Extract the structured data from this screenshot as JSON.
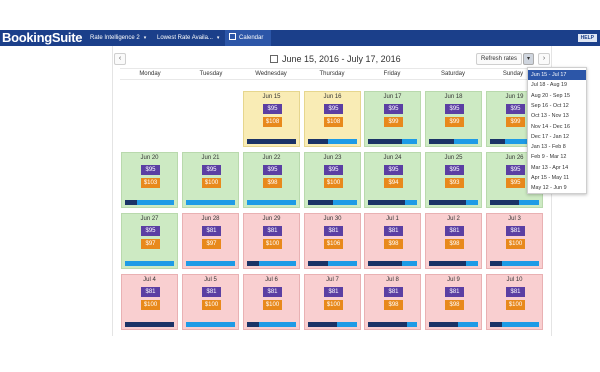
{
  "header": {
    "logo": "BookingSuite",
    "nav": [
      {
        "label": "Rate Intelligence 2",
        "caret": "▾"
      },
      {
        "label": "Lowest Rate Availa...",
        "caret": "▾"
      },
      {
        "label": "Calendar",
        "caret": ""
      }
    ],
    "help": "HELP"
  },
  "toolbar": {
    "prev": "‹",
    "next": "›",
    "date_range": "June 15, 2016 - July 17, 2016",
    "refresh": "Refresh rates",
    "dropdown_toggle": "▾"
  },
  "weekdays": [
    "Monday",
    "Tuesday",
    "Wednesday",
    "Thursday",
    "Friday",
    "Saturday",
    "Sunday"
  ],
  "calendar": [
    {
      "date": "Jun 15",
      "rate": "$95",
      "compare": "$108",
      "status": "yellow",
      "bar_fill": 1.0
    },
    {
      "date": "Jun 16",
      "rate": "$95",
      "compare": "$108",
      "status": "yellow",
      "bar_fill": 0.4
    },
    {
      "date": "Jun 17",
      "rate": "$95",
      "compare": "$99",
      "status": "green",
      "bar_fill": 0.7
    },
    {
      "date": "Jun 18",
      "rate": "$95",
      "compare": "$99",
      "status": "green",
      "bar_fill": 0.5
    },
    {
      "date": "Jun 19",
      "rate": "$95",
      "compare": "$99",
      "status": "green",
      "bar_fill": 0.3
    },
    {
      "date": "Jun 20",
      "rate": "$95",
      "compare": "$103",
      "status": "green",
      "bar_fill": 0.25
    },
    {
      "date": "Jun 21",
      "rate": "$95",
      "compare": "$100",
      "status": "green",
      "bar_fill": 0.0
    },
    {
      "date": "Jun 22",
      "rate": "$95",
      "compare": "$98",
      "status": "green",
      "bar_fill": 0.0
    },
    {
      "date": "Jun 23",
      "rate": "$95",
      "compare": "$100",
      "status": "green",
      "bar_fill": 0.5
    },
    {
      "date": "Jun 24",
      "rate": "$95",
      "compare": "$94",
      "status": "green",
      "bar_fill": 0.75
    },
    {
      "date": "Jun 25",
      "rate": "$95",
      "compare": "$93",
      "status": "green",
      "bar_fill": 0.75
    },
    {
      "date": "Jun 26",
      "rate": "$95",
      "compare": "$95",
      "status": "green",
      "bar_fill": 0.6
    },
    {
      "date": "Jun 27",
      "rate": "$95",
      "compare": "$97",
      "status": "green",
      "bar_fill": 0.0
    },
    {
      "date": "Jun 28",
      "rate": "$81",
      "compare": "$97",
      "status": "red",
      "bar_fill": 0.0
    },
    {
      "date": "Jun 29",
      "rate": "$81",
      "compare": "$100",
      "status": "red",
      "bar_fill": 0.25
    },
    {
      "date": "Jun 30",
      "rate": "$81",
      "compare": "$106",
      "status": "red",
      "bar_fill": 0.4
    },
    {
      "date": "Jul 1",
      "rate": "$81",
      "compare": "$98",
      "status": "red",
      "bar_fill": 0.7
    },
    {
      "date": "Jul 2",
      "rate": "$81",
      "compare": "$98",
      "status": "red",
      "bar_fill": 0.75
    },
    {
      "date": "Jul 3",
      "rate": "$81",
      "compare": "$100",
      "status": "red",
      "bar_fill": 0.25
    },
    {
      "date": "Jul 4",
      "rate": "$81",
      "compare": "$100",
      "status": "red",
      "bar_fill": 1.0
    },
    {
      "date": "Jul 5",
      "rate": "$81",
      "compare": "$100",
      "status": "red",
      "bar_fill": 0.0
    },
    {
      "date": "Jul 6",
      "rate": "$81",
      "compare": "$100",
      "status": "red",
      "bar_fill": 0.25
    },
    {
      "date": "Jul 7",
      "rate": "$81",
      "compare": "$100",
      "status": "red",
      "bar_fill": 0.6
    },
    {
      "date": "Jul 8",
      "rate": "$81",
      "compare": "$98",
      "status": "red",
      "bar_fill": 0.8
    },
    {
      "date": "Jul 9",
      "rate": "$81",
      "compare": "$98",
      "status": "red",
      "bar_fill": 0.6
    },
    {
      "date": "Jul 10",
      "rate": "$81",
      "compare": "$100",
      "status": "red",
      "bar_fill": 0.25
    }
  ],
  "period_dropdown": {
    "selected": "Jun 15 - Jul 17",
    "options": [
      "Jun 15 - Jul 17",
      "Jul 18 - Aug 19",
      "Aug 20 - Sep 15",
      "Sep 16 - Oct 12",
      "Oct 13 - Nov 13",
      "Nov 14 - Dec 16",
      "Dec 17 - Jan 12",
      "Jan 13 - Feb 8",
      "Feb 9 - Mar 12",
      "Mar 13 - Apr 14",
      "Apr 15 - May 11",
      "May 12 - Jun 9"
    ]
  },
  "colors": {
    "header": "#1b3f8a",
    "cell_green": "#cdeac3",
    "cell_yellow": "#f9ecb5",
    "cell_red": "#f9cfd0",
    "rate_badge": "#5b3fa3",
    "compare_badge": "#e8891c",
    "bar": "#1e9be6",
    "bar_fill": "#1b3366"
  }
}
